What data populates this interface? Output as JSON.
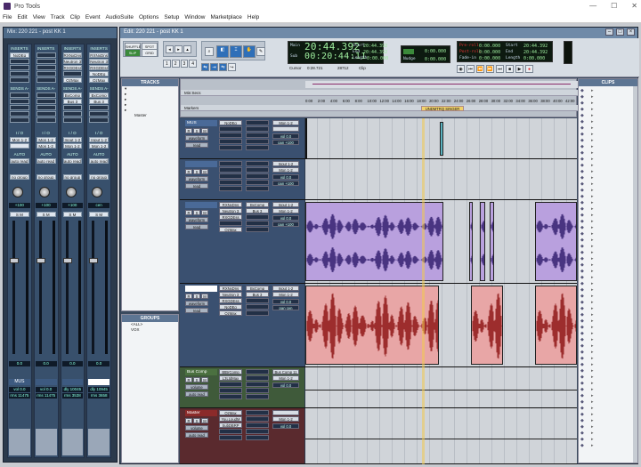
{
  "window": {
    "title": "Pro Tools"
  },
  "menu": [
    "File",
    "Edit",
    "View",
    "Track",
    "Clip",
    "Event",
    "AudioSuite",
    "Options",
    "Setup",
    "Window",
    "Marketplace",
    "Help"
  ],
  "mix": {
    "title": "Mix: 220 221 - post KK 1",
    "strips": [
      {
        "inserts_label": "INSERTS A-E",
        "inserts": [
          "NoDEq",
          "",
          "",
          "",
          ""
        ],
        "sends_label": "SENDS A-E",
        "io_in": "Mon 1-2",
        "io_out": "",
        "auto": "auto read",
        "group": "no group",
        "pan": "+100",
        "vol": "0.0",
        "name": "MUS",
        "rdA": "vol",
        "rdB": "0.0",
        "rdC": "rms",
        "rdD": "11475"
      },
      {
        "inserts_label": "INSERTS A-E",
        "inserts": [
          "",
          "",
          "",
          "",
          ""
        ],
        "sends_label": "SENDS A-E",
        "io_in": "Mon 1-2",
        "io_out": "Mon 1-2",
        "auto": "auto read",
        "group": "no group",
        "pan": "+100",
        "vol": "0.0",
        "name": "",
        "rdA": "vol",
        "rdB": "0.0",
        "rdC": "rms",
        "rdD": "11475"
      },
      {
        "inserts_label": "INSERTS A-E",
        "inserts": [
          "RXNxDns",
          "Neutron 3",
          "RXGDEss",
          "",
          "OzMax"
        ],
        "sends_label": "SENDS A-E",
        "sends": [
          "BxComp",
          "Bus 3"
        ],
        "io_in": "Input 1-2",
        "io_out": "Mon 1-2",
        "auto": "auto read",
        "group": "no group",
        "pan": "+100",
        "vol": "0.0",
        "name": "",
        "rdA": "dly",
        "rdB": "10045",
        "rdC": "rms",
        "rdD": "3538"
      },
      {
        "inserts_label": "INSERTS A-E",
        "inserts": [
          "RXNxDns",
          "Neutron 3",
          "RXGDEss",
          "NoDEq",
          "OzMax"
        ],
        "sends_label": "SENDS A-E",
        "sends": [
          "BxComp",
          "Bus 3"
        ],
        "io_in": "Input 1-2",
        "io_out": "Mon 1-2",
        "auto": "auto read",
        "group": "no group",
        "pan": "cen",
        "vol": "0.0",
        "name": "",
        "rdA": "dly",
        "rdB": "10945",
        "rdC": "rms",
        "rdD": "3658"
      }
    ]
  },
  "edit": {
    "title": "Edit: 220 221 - post KK 1",
    "mode": {
      "shuffle": "SHUFFLE",
      "spot": "SPOT",
      "slip": "SLIP",
      "grid": "GRID"
    },
    "main_counter": {
      "label": "Main",
      "value": "20:44.392",
      "sub_label": "Sub",
      "sub_value": "00:20:44:11",
      "start_label": "Start",
      "start": "20:44.392",
      "end_label": "End",
      "end": "20:44.392",
      "length_label": "Length",
      "length": "0:00.000"
    },
    "cursor": {
      "label": "Cursor",
      "value": "0:28.721",
      "sample": "28712",
      "clip": "Clip"
    },
    "nudge": {
      "label": "Nudge",
      "value": "0:00.000",
      "grid": "0:00.000"
    },
    "pre_roll": {
      "label": "Pre-roll",
      "value": "0:00.000",
      "post_label": "Post-roll",
      "post": "0:00.000",
      "fadein_label": "Fade-in",
      "fadein": "0:00.000"
    },
    "tc_start": {
      "start_label": "Start",
      "start": "20:44.392",
      "end_label": "End",
      "end": "20:44.392",
      "length_label": "Length",
      "length": "0:00.000"
    },
    "tracks_panel": {
      "title": "TRACKS",
      "items": [
        "▾",
        "▸",
        "▸",
        "▸",
        "▸",
        "Master"
      ]
    },
    "groups_panel": {
      "title": "GROUPS",
      "items": [
        "<ALL>",
        "VOX"
      ]
    },
    "ruler": {
      "minsecs": "Min:Secs",
      "markers": "Markers",
      "ticks": [
        "0:00",
        "2:00",
        "4:00",
        "6:00",
        "8:00",
        "10:00",
        "12:00",
        "14:00",
        "16:00",
        "18:00",
        "20:00",
        "22:00",
        "24:00",
        "26:00",
        "28:00",
        "30:00",
        "32:00",
        "34:00",
        "36:00",
        "38:00",
        "40:00",
        "42:00"
      ],
      "marker_label": "UNDMTRQ SINGER"
    },
    "tracks": [
      {
        "name": "MUS",
        "inserts": [
          "NoDEq"
        ],
        "io_in": "Mon 1-2",
        "vol": "0.0",
        "pan": "+100",
        "view": "waveform",
        "dyn": "read"
      },
      {
        "name": "",
        "inserts": [],
        "io_in": "Input 1-2",
        "io_out": "Mon 1-2",
        "vol": "0.0",
        "pan": "+100",
        "view": "waveform",
        "dyn": "read"
      },
      {
        "name": "",
        "inserts": [
          "RXNxDns",
          "Neutron 3",
          "RXGDEss",
          "",
          "OzMax"
        ],
        "sends": [
          "BxComp",
          "Bus 3"
        ],
        "io_in": "Input 1-2",
        "io_out": "Mon 1-2",
        "vol": "0.0",
        "pan": "+100",
        "view": "waveform",
        "dyn": "read"
      },
      {
        "name": "",
        "inserts": [
          "RXNxDns",
          "Neutron 3",
          "RXGDEss",
          "NoDEq",
          "OzMax"
        ],
        "sends": [
          "BxComp",
          "Bus 3"
        ],
        "io_in": "Input 1-2",
        "io_out": "Mon 1-2",
        "vol": "0.0",
        "pan": "cen",
        "view": "waveform",
        "dyn": "read"
      },
      {
        "name": "Bus Comp",
        "inserts": [
          "BtBrComp",
          "L3LtdMax"
        ],
        "io_in": "Bus Comp 11",
        "io_out": "Mon 1-2",
        "vol": "0.0",
        "view": "volume",
        "dyn": "auto read"
      },
      {
        "name": "Master",
        "inserts": [
          "OzMax",
          "You.LoudM",
          "SubDBRP"
        ],
        "io_out": "Mon 1-2",
        "vol": "0.0",
        "view": "volume",
        "dyn": "auto read"
      }
    ],
    "clips_panel": {
      "title": "CLIPS"
    }
  },
  "colors": {
    "purple_clip": "#b9a0de",
    "red_clip": "#e8a6a6",
    "purple_wave": "#2e1a6a",
    "red_wave": "#8a0f0f"
  }
}
